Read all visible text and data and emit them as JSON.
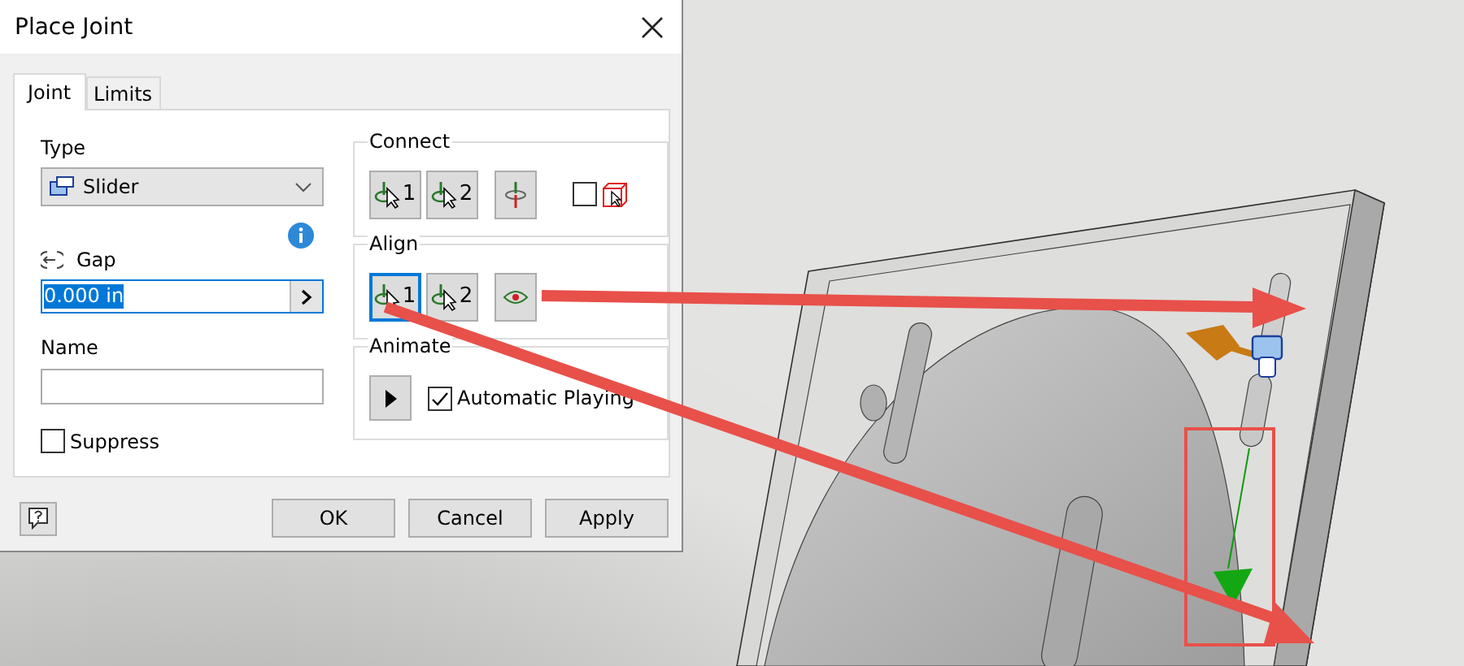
{
  "window": {
    "title": "Place Joint"
  },
  "tabs": [
    {
      "label": "Joint",
      "selected": true
    },
    {
      "label": "Limits",
      "selected": false
    }
  ],
  "type": {
    "label": "Type",
    "value": "Slider"
  },
  "gap": {
    "label": "Gap",
    "value": "0.000 in",
    "selected": true
  },
  "name": {
    "label": "Name"
  },
  "suppress": {
    "label": "Suppress",
    "checked": false
  },
  "connect": {
    "title": "Connect",
    "buttons": [
      {
        "label": "1",
        "selected": false
      },
      {
        "label": "2",
        "selected": false
      }
    ],
    "checkbox": {
      "checked": false
    }
  },
  "align": {
    "title": "Align",
    "buttons": [
      {
        "label": "1",
        "selected": true
      },
      {
        "label": "2",
        "selected": false
      }
    ]
  },
  "animate": {
    "title": "Animate",
    "automatic_playing": {
      "label": "Automatic Playing",
      "checked": true
    }
  },
  "buttons": [
    "OK",
    "Cancel",
    "Apply"
  ]
}
